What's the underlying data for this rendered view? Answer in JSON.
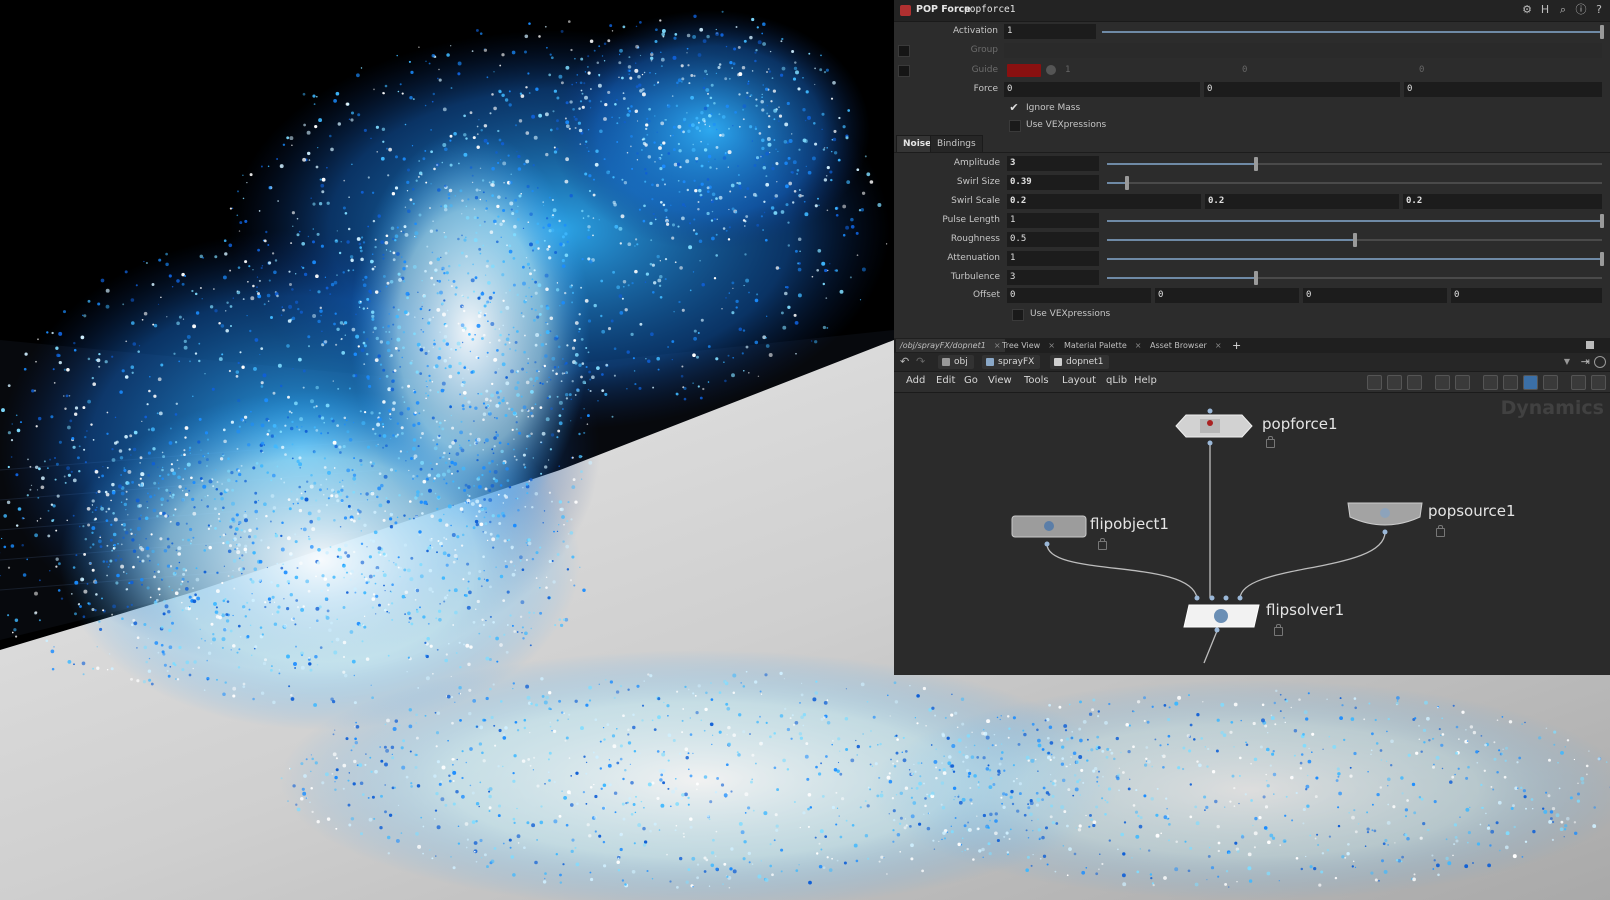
{
  "param_panel": {
    "title": {
      "op_type": "POP Force",
      "op_name": "popforce1"
    },
    "activation": {
      "label": "Activation",
      "value": "1",
      "level": 1.0
    },
    "group": {
      "label": "Group",
      "value": ""
    },
    "guide": {
      "label": "Guide",
      "values": [
        "1",
        "0",
        "0"
      ],
      "color": "#8a1010"
    },
    "force": {
      "label": "Force",
      "values": [
        "0",
        "0",
        "0"
      ]
    },
    "ignore_mass": {
      "label": "Ignore Mass",
      "checked": true
    },
    "use_vex_top": {
      "label": "Use VEXpressions",
      "checked": false
    },
    "tabs": [
      "Noise",
      "Bindings"
    ],
    "noise": {
      "amplitude": {
        "label": "Amplitude",
        "value": "3",
        "level": 0.3
      },
      "swirl_size": {
        "label": "Swirl Size",
        "value": "0.39",
        "level": 0.04
      },
      "swirl_scale": {
        "label": "Swirl Scale",
        "values": [
          "0.2",
          "0.2",
          "0.2"
        ]
      },
      "pulse_length": {
        "label": "Pulse Length",
        "value": "1",
        "level": 1.0
      },
      "roughness": {
        "label": "Roughness",
        "value": "0.5",
        "level": 0.5
      },
      "attenuation": {
        "label": "Attenuation",
        "value": "1",
        "level": 1.0
      },
      "turbulence": {
        "label": "Turbulence",
        "value": "3",
        "level": 0.3
      },
      "offset": {
        "label": "Offset",
        "values": [
          "0",
          "0",
          "0",
          "0"
        ]
      },
      "use_vex": {
        "label": "Use VEXpressions",
        "checked": false
      }
    }
  },
  "network": {
    "pane_tabs": [
      "/obj/sprayFX/dopnet1",
      "Tree View",
      "Material Palette",
      "Asset Browser"
    ],
    "path": [
      "obj",
      "sprayFX",
      "dopnet1"
    ],
    "menus": [
      "Add",
      "Edit",
      "Go",
      "View",
      "Tools",
      "Layout",
      "qLib",
      "Help"
    ],
    "context_label": "Dynamics",
    "nodes": {
      "popforce": "popforce1",
      "flipobject": "flipobject1",
      "popsource": "popsource1",
      "flipsolver": "flipsolver1"
    }
  },
  "colors": {
    "water_blue": "#1a8cff",
    "foam_white": "#ffffff",
    "ocean_grey": "#b8b8b8",
    "accent_red": "#b03030"
  }
}
